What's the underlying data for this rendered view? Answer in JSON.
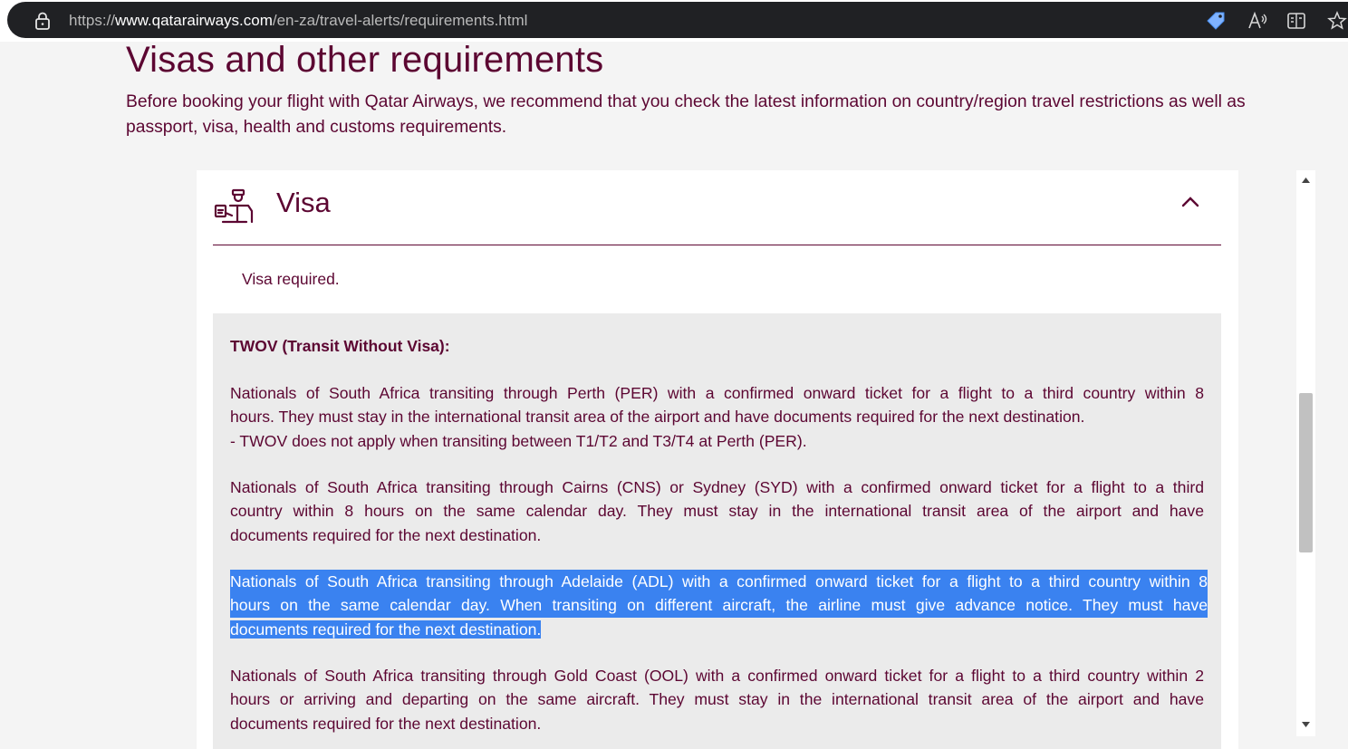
{
  "browser": {
    "url_prefix": "https://",
    "url_domain": "www.qatarairways.com",
    "url_path": "/en-za/travel-alerts/requirements.html"
  },
  "page": {
    "title": "Visas and other requirements",
    "intro": "Before booking your flight with Qatar Airways, we recommend that you check the latest information on country/region travel restrictions as well as passport, visa, health and customs requirements."
  },
  "visa_section": {
    "title": "Visa",
    "status": "Visa required.",
    "twov_heading": "TWOV (Transit Without Visa):",
    "paragraphs": [
      {
        "lines": [
          "Nationals of South Africa transiting through Perth (PER) with a confirmed onward ticket for a flight to a third country within 8",
          "hours. They must stay in the international transit area of the airport and have documents required for the next destination.",
          "- TWOV does not apply when transiting between T1/T2 and T3/T4 at Perth (PER)."
        ]
      },
      {
        "lines": [
          "Nationals of South Africa transiting through Cairns (CNS) or Sydney (SYD) with a confirmed onward ticket for a flight to a third",
          "country within 8 hours on the same calendar day. They must stay in the international transit area of the airport and have",
          "documents required for the next destination."
        ]
      },
      {
        "lines": [
          "Nationals of South Africa transiting through Adelaide (ADL) with a confirmed onward ticket for a flight to a third country within 8",
          "hours on the same calendar day. When transiting on different aircraft, the airline must give advance notice. They must have",
          "documents required for the next destination."
        ],
        "selected": true
      },
      {
        "lines": [
          "Nationals of South Africa transiting through Gold Coast (OOL) with a confirmed onward ticket for a flight to a third country within 2",
          "hours or arriving and departing on the same aircraft. They must stay in the international transit area of the airport and have",
          "documents required for the next destination."
        ]
      }
    ]
  },
  "colors": {
    "brand": "#5c0632",
    "selection": "#3a82f0",
    "box_bg": "#ebebeb"
  },
  "icons": [
    "lock-icon",
    "price-tag-icon",
    "read-aloud-icon",
    "reader-view-icon",
    "favorite-star-icon",
    "visa-officer-icon",
    "chevron-up-icon"
  ]
}
